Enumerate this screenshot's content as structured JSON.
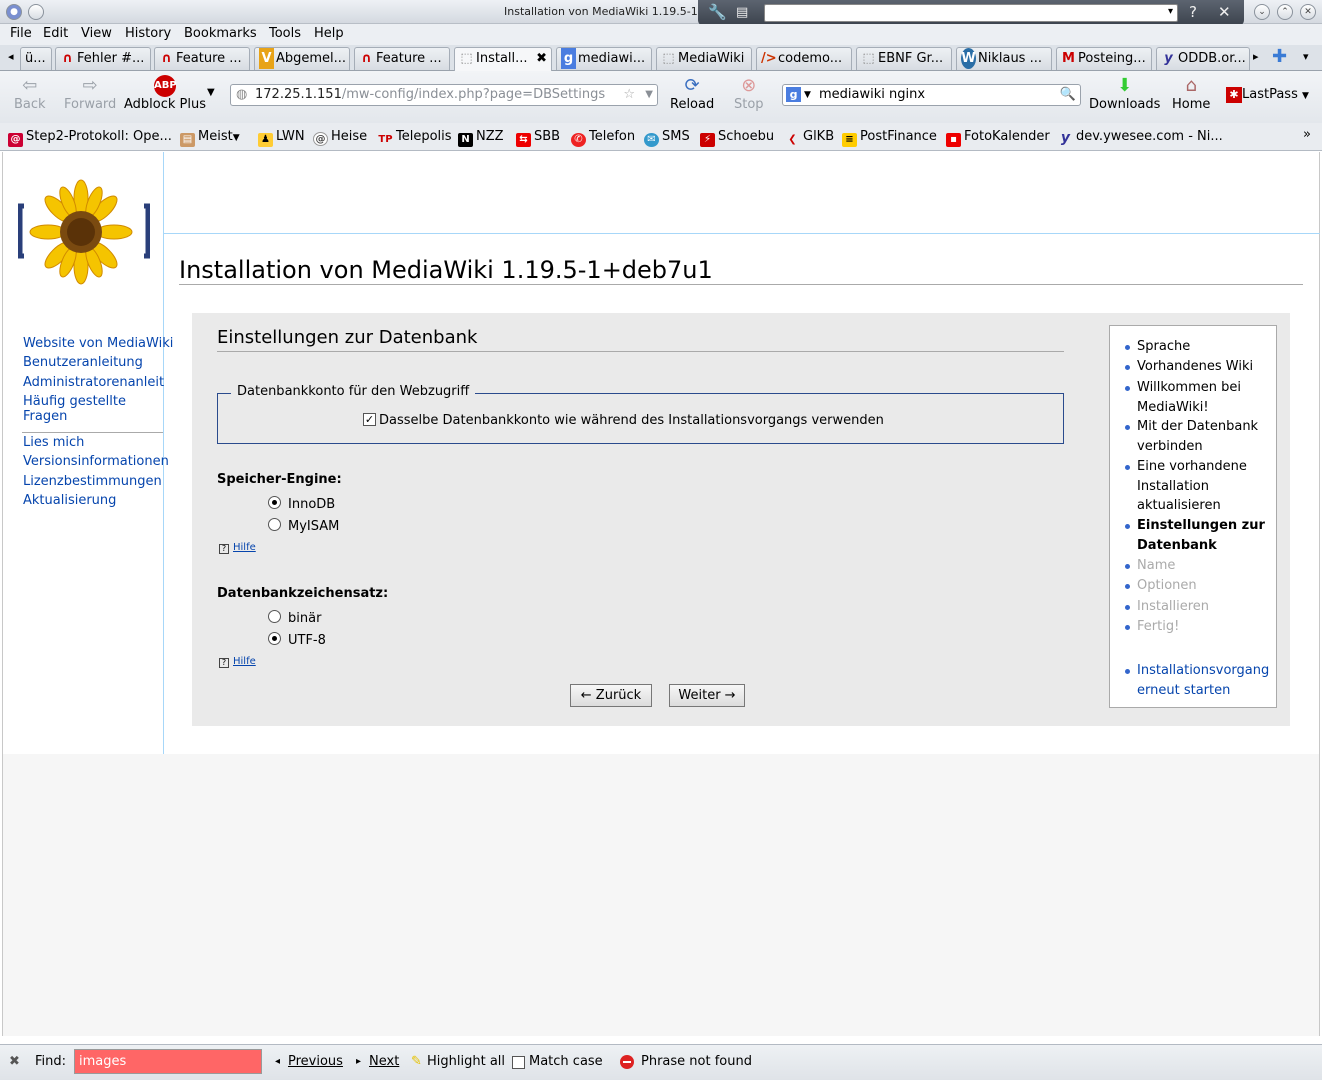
{
  "window": {
    "title": "Installation von MediaWiki 1.19.5-1"
  },
  "menu": [
    "File",
    "Edit",
    "View",
    "History",
    "Bookmarks",
    "Tools",
    "Help"
  ],
  "tabs": [
    {
      "label": "ü...",
      "icon": "tab-scroll-icon"
    },
    {
      "label": "Fehler #...",
      "icon": "redhat-icon"
    },
    {
      "label": "Feature ...",
      "icon": "redhat-icon"
    },
    {
      "label": "Abgemel...",
      "icon": "v-icon"
    },
    {
      "label": "Feature ...",
      "icon": "redhat-icon"
    },
    {
      "label": "Install...",
      "icon": "page-icon"
    },
    {
      "label": "mediawi...",
      "icon": "google-icon"
    },
    {
      "label": "MediaWiki",
      "icon": "page-icon"
    },
    {
      "label": "codemo...",
      "icon": "code-icon"
    },
    {
      "label": "EBNF Gr...",
      "icon": "page-icon"
    },
    {
      "label": "Niklaus ...",
      "icon": "wordpress-icon"
    },
    {
      "label": "Posteing...",
      "icon": "gmail-icon"
    },
    {
      "label": "ODDB.or...",
      "icon": "yahoo-icon"
    }
  ],
  "nav": {
    "back": "Back",
    "forward": "Forward",
    "adblock": "Adblock Plus",
    "reload": "Reload",
    "stop": "Stop",
    "downloads": "Downloads",
    "home": "Home",
    "lastpass": "LastPass",
    "url_host": "172.25.1.151",
    "url_path": "/mw-config/index.php?page=DBSettings",
    "search_value": "mediawiki nginx"
  },
  "bookmarks": [
    {
      "label": "Step2-Protokoll: Ope...",
      "color": "#c03"
    },
    {
      "label": "Meist",
      "color": "#c96"
    },
    {
      "label": "LWN",
      "color": "#fc3"
    },
    {
      "label": "Heise",
      "color": "#666"
    },
    {
      "label": "Telepolis",
      "color": "#c00"
    },
    {
      "label": "NZZ",
      "color": "#000"
    },
    {
      "label": "SBB",
      "color": "#e00"
    },
    {
      "label": "Telefon",
      "color": "#e22"
    },
    {
      "label": "SMS",
      "color": "#39c"
    },
    {
      "label": "Schoebu",
      "color": "#c00"
    },
    {
      "label": "GlKB",
      "color": "#c00"
    },
    {
      "label": "PostFinance",
      "color": "#fc0"
    },
    {
      "label": "FotoKalender",
      "color": "#e00"
    },
    {
      "label": "dev.ywesee.com - Ni...",
      "color": "#339"
    }
  ],
  "leftnav": {
    "group1": [
      "Website von MediaWiki",
      "Benutzeranleitung",
      "Administratorenanleitung",
      "Häufig gestellte Fragen"
    ],
    "group2": [
      "Lies mich",
      "Versionsinformationen",
      "Lizenzbestimmungen",
      "Aktualisierung"
    ]
  },
  "page": {
    "heading": "Installation von MediaWiki 1.19.5-1+deb7u1",
    "section": "Einstellungen zur Datenbank",
    "fieldset_legend": "Datenbankkonto für den Webzugriff",
    "same_account_label": "Dasselbe Datenbankkonto wie während des Installationsvorgangs verwenden",
    "same_account_checked": true,
    "engine_label": "Speicher-Engine:",
    "engine_options": [
      "InnoDB",
      "MyISAM"
    ],
    "engine_selected": "InnoDB",
    "charset_label": "Datenbankzeichensatz:",
    "charset_options": [
      "binär",
      "UTF-8"
    ],
    "charset_selected": "UTF-8",
    "help": "Hilfe",
    "back_button": "← Zurück",
    "next_button": "Weiter →"
  },
  "steps": [
    {
      "label": "Sprache",
      "state": "done"
    },
    {
      "label": "Vorhandenes Wiki",
      "state": "done"
    },
    {
      "label": "Willkommen bei MediaWiki!",
      "state": "done"
    },
    {
      "label": "Mit der Datenbank verbinden",
      "state": "done"
    },
    {
      "label": "Eine vorhandene Installation aktualisieren",
      "state": "done"
    },
    {
      "label": "Einstellungen zur Datenbank",
      "state": "current"
    },
    {
      "label": "Name",
      "state": "pending"
    },
    {
      "label": "Optionen",
      "state": "pending"
    },
    {
      "label": "Installieren",
      "state": "pending"
    },
    {
      "label": "Fertig!",
      "state": "pending"
    }
  ],
  "restart_link": "Installationsvorgang erneut starten",
  "findbar": {
    "label": "Find:",
    "value": "images",
    "previous": "Previous",
    "next": "Next",
    "highlight": "Highlight all",
    "match_case": "Match case",
    "status": "Phrase not found"
  },
  "colors": {
    "link": "#0645ad",
    "panel": "#eaeaea",
    "find_error": "#ff6666"
  }
}
